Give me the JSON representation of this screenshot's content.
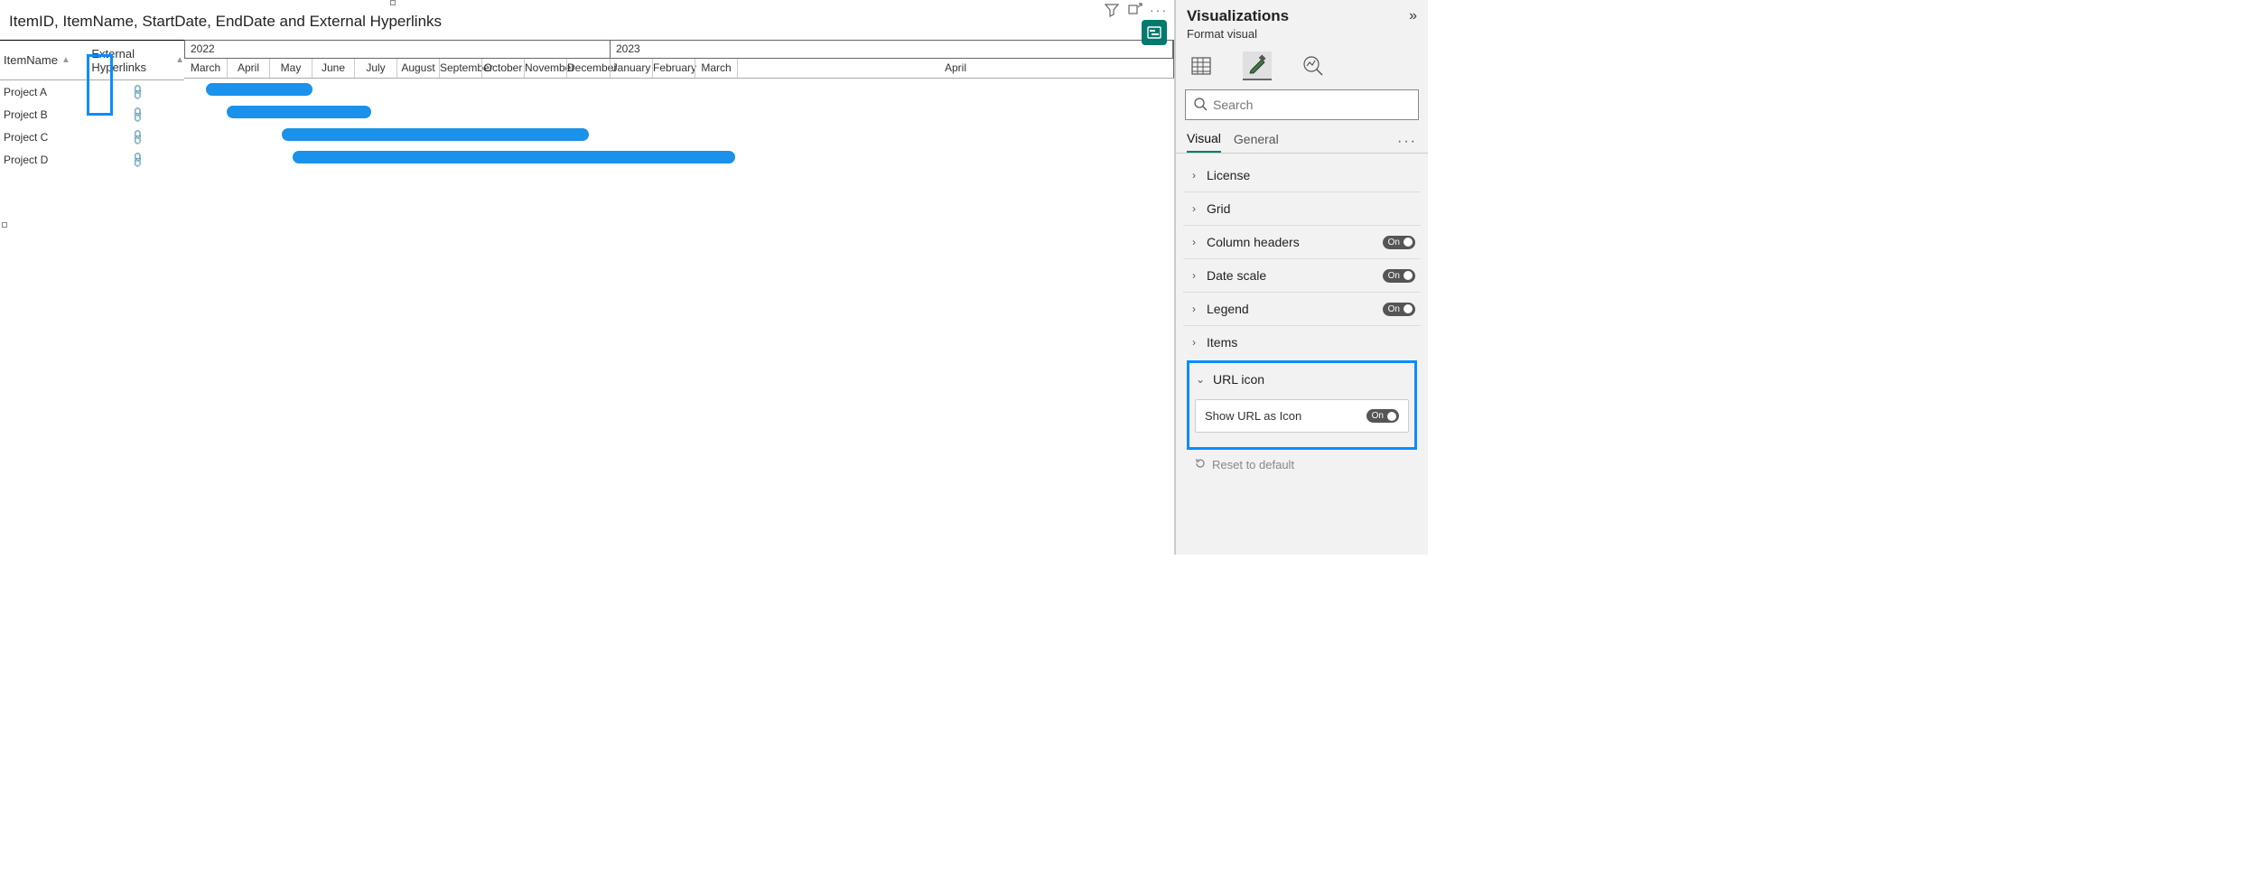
{
  "title": "ItemID, ItemName, StartDate, EndDate and External Hyperlinks",
  "columns": {
    "c1": "ItemName",
    "c2": "External Hyperlinks"
  },
  "rows": [
    {
      "name": "Project A"
    },
    {
      "name": "Project B"
    },
    {
      "name": "Project C"
    },
    {
      "name": "Project D"
    }
  ],
  "years": {
    "y1": "2022",
    "y2": "2023"
  },
  "months": [
    "March",
    "April",
    "May",
    "June",
    "July",
    "August",
    "September",
    "October",
    "November",
    "December",
    "January",
    "February",
    "March",
    "April"
  ],
  "panel": {
    "title": "Visualizations",
    "subtitle": "Format visual",
    "search_placeholder": "Search",
    "tabs": {
      "visual": "Visual",
      "general": "General"
    },
    "sections": {
      "license": "License",
      "grid": "Grid",
      "column_headers": "Column headers",
      "date_scale": "Date scale",
      "legend": "Legend",
      "items": "Items",
      "url_icon": "URL icon",
      "show_url": "Show URL as Icon"
    },
    "toggle_label": "On",
    "reset": "Reset to default"
  },
  "chart_data": {
    "type": "gantt",
    "title": "ItemID, ItemName, StartDate, EndDate and External Hyperlinks",
    "x_axis": {
      "start": "2022-03",
      "end": "2023-04"
    },
    "items": [
      {
        "name": "Project A",
        "start": "2022-03",
        "end": "2022-06"
      },
      {
        "name": "Project B",
        "start": "2022-04",
        "end": "2022-07"
      },
      {
        "name": "Project C",
        "start": "2022-05",
        "end": "2022-12"
      },
      {
        "name": "Project D",
        "start": "2022-06",
        "end": "2023-03"
      }
    ]
  }
}
